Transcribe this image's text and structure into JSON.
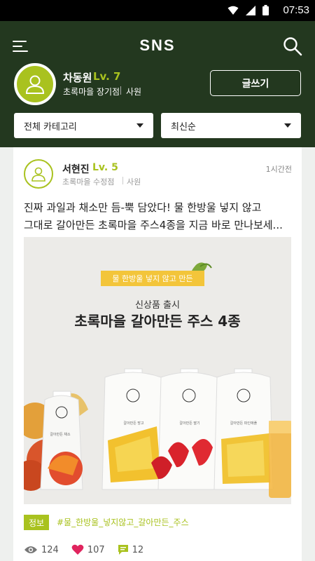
{
  "status_bar": {
    "time": "07:53",
    "icons": [
      "wifi-icon",
      "signal-icon",
      "battery-icon"
    ]
  },
  "header": {
    "title": "SNS"
  },
  "profile": {
    "name": "차동원",
    "level": "Lv. 7",
    "store": "초록마을 장기점",
    "role": "사원",
    "write_button": "글쓰기"
  },
  "filters": {
    "category": "전체 카테고리",
    "sort": "최신순"
  },
  "post": {
    "author_name": "서현진",
    "author_level": "Lv. 5",
    "author_store": "초록마을 수정점",
    "author_role": "사원",
    "time": "1시간전",
    "text_line1": "진짜 과일과 채소만 듬-뿍 담았다! 물 한방울 넣지 않고",
    "text_line2": "그대로 갈아만든 초록마을 주스4종을 지금 바로 만나보세...",
    "image": {
      "banner": "물 한방울 넣지 않고 만든",
      "subtitle": "신상품 출시",
      "title": "초록마을 갈아만든 주스 4종",
      "pouches": [
        {
          "label": "갈아만든 채소"
        },
        {
          "label": "갈아만든 망고"
        },
        {
          "label": "갈아만든 딸기"
        },
        {
          "label": "갈아만든 파인애플"
        }
      ]
    },
    "tag_label": "정보",
    "hashtag": "#물_한방울_넣지않고_갈아만든_주스",
    "stats": {
      "views": "124",
      "likes": "107",
      "comments": "12"
    }
  },
  "colors": {
    "header_bg": "#23381f",
    "accent": "#a9c21f",
    "like": "#e0245e"
  }
}
